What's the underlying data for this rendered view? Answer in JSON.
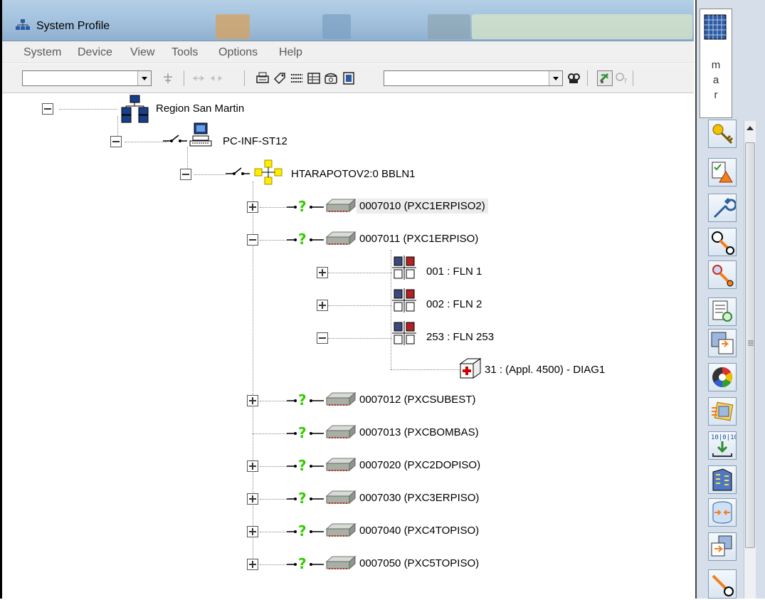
{
  "window": {
    "title": "System Profile",
    "title_icon": "network-tree-icon"
  },
  "menu": [
    "System",
    "Device",
    "View",
    "Tools",
    "Options",
    "Help"
  ],
  "toolbar": {
    "combo_left_value": "",
    "combo_right_value": "",
    "buttons": [
      "tree-add-icon",
      "link-icon",
      "unlink-icon",
      "printer-icon",
      "tag-icon",
      "list-icon",
      "grid-icon",
      "phone-icon",
      "info-icon",
      "find-icon",
      "satellite-icon",
      "help-icon"
    ]
  },
  "tree": {
    "root": "Region San Martin",
    "pc": "PC-INF-ST12",
    "network": "HTARAPOTOV2:0   BBLN1",
    "controllers": [
      {
        "label": "0007010 (PXC1ERPISO2)",
        "state": "collapsed",
        "selected": true
      },
      {
        "label": "0007011 (PXC1ERPISO)",
        "state": "expanded"
      },
      {
        "label": "0007012 (PXCSUBEST)",
        "state": "collapsed"
      },
      {
        "label": "0007013 (PXCBOMBAS)",
        "state": "leaf"
      },
      {
        "label": "0007020 (PXC2DOPISO)",
        "state": "collapsed"
      },
      {
        "label": "0007030 (PXC3ERPISO)",
        "state": "collapsed"
      },
      {
        "label": "0007040 (PXC4TOPISO)",
        "state": "collapsed"
      },
      {
        "label": "0007050 (PXC5TOPISO)",
        "state": "collapsed"
      }
    ],
    "flns": [
      {
        "label": "001 : FLN 1",
        "state": "collapsed"
      },
      {
        "label": "002 : FLN 2",
        "state": "collapsed"
      },
      {
        "label": "253 : FLN 253",
        "state": "expanded"
      }
    ],
    "device": "31 : (Appl. 4500) - DIAG1"
  },
  "right_panel": {
    "letters": [
      "m",
      "a",
      "r"
    ],
    "icons": [
      "key-icon",
      "alarm-checklist-icon",
      "wrench-icon",
      "point-commander-icon",
      "trend-icon",
      "report-icon",
      "copy-icon",
      "color-wheel-icon",
      "graphics-icon",
      "binary-download-icon",
      "building-icon",
      "database-icon",
      "import-icon",
      "pen-icon"
    ]
  },
  "colors": {
    "titlebar": "#a3c2de",
    "question_mark": "#33cc00",
    "selected_row": "#ececec"
  }
}
